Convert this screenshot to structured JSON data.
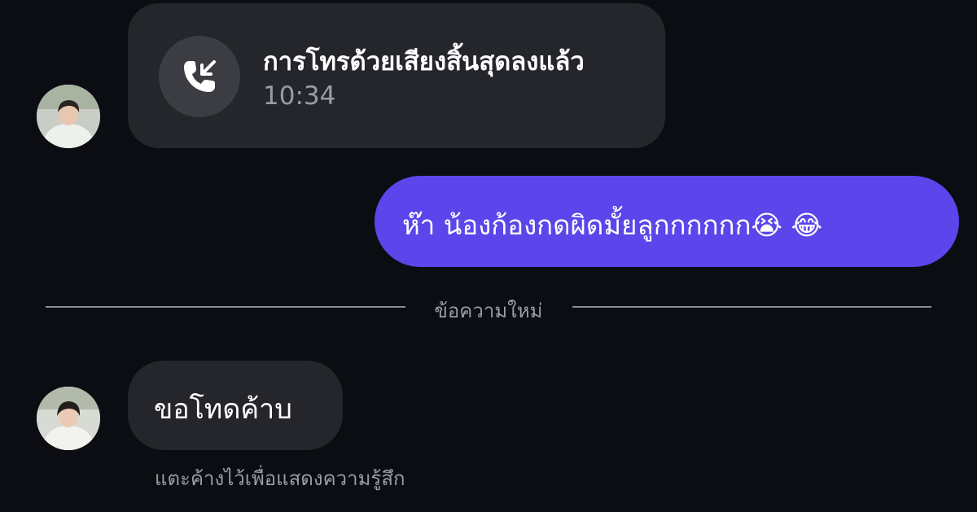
{
  "messages": {
    "call": {
      "title": "การโทรด้วยเสียงสิ้นสุดลงแล้ว",
      "duration": "10:34",
      "icon": "phone-incoming-icon"
    },
    "outgoing": {
      "text": "ห๊า น้องก้องกดผิดมั้ยลูกกกกกก😭 😂"
    },
    "divider": {
      "label": "ข้อความใหม่"
    },
    "incoming": {
      "text": "ขอโทดค้าบ",
      "hint": "แตะค้างไว้เพื่อแสดงความรู้สึก"
    }
  },
  "colors": {
    "background": "#0b0d12",
    "incoming_bubble": "#24262b",
    "outgoing_bubble": "#5c45ea",
    "icon_circle": "#3b3d43",
    "muted_text": "#9a9ca3",
    "divider": "#8b8e96"
  }
}
